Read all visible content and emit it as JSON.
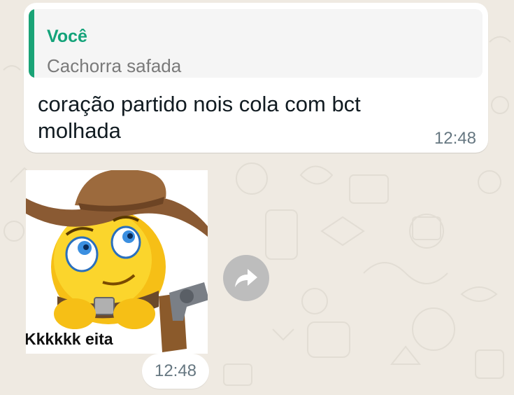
{
  "message": {
    "quote_author": "Você",
    "quote_text": "Cachorra safada",
    "text": "coração partido nois cola com bct molhada",
    "time": "12:48"
  },
  "sticker": {
    "caption": "Kkkkkk eita",
    "icon": "cowboy-emoji-sticker",
    "time": "12:48"
  },
  "forward_button": {
    "icon": "forward-arrow-icon"
  },
  "colors": {
    "wallpaper": "#efeae2",
    "bubble": "#ffffff",
    "quote_accent": "#1aa376",
    "time_text": "#667781"
  }
}
